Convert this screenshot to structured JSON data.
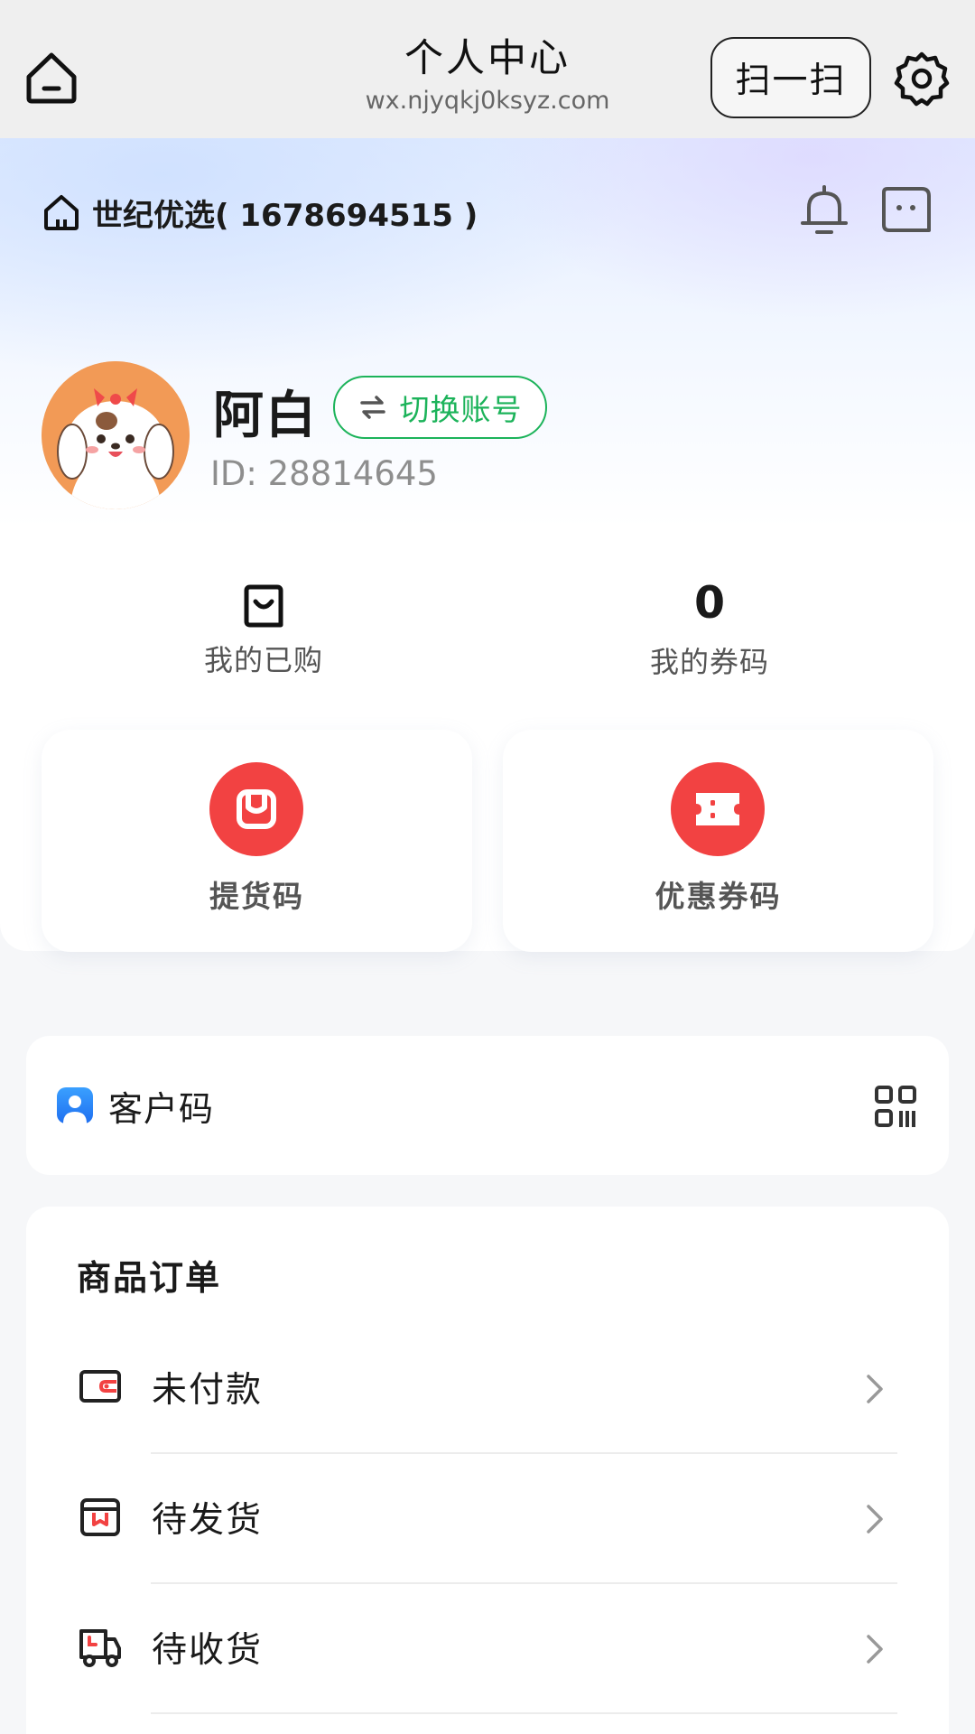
{
  "navbar": {
    "title": "个人中心",
    "url": "wx.njyqkj0ksyz.com",
    "scan_label": "扫一扫"
  },
  "shop": {
    "name": "世纪优选( 1678694515 )"
  },
  "user": {
    "name": "阿白",
    "switch_label": "切换账号",
    "id_text": "ID: 28814645"
  },
  "stats": {
    "purchased_label": "我的已购",
    "coupon_count": "0",
    "coupon_label": "我的券码"
  },
  "cards": {
    "pickup_label": "提货码",
    "coupon_label": "优惠券码"
  },
  "customer_code": {
    "label": "客户码"
  },
  "orders": {
    "title": "商品订单",
    "items": [
      {
        "label": "未付款",
        "icon": "wallet-icon"
      },
      {
        "label": "待发货",
        "icon": "package-icon"
      },
      {
        "label": "待收货",
        "icon": "truck-icon"
      }
    ]
  },
  "colors": {
    "accent_green": "#1cb35a",
    "accent_red": "#f24242",
    "accent_blue": "#2f7bf5"
  }
}
